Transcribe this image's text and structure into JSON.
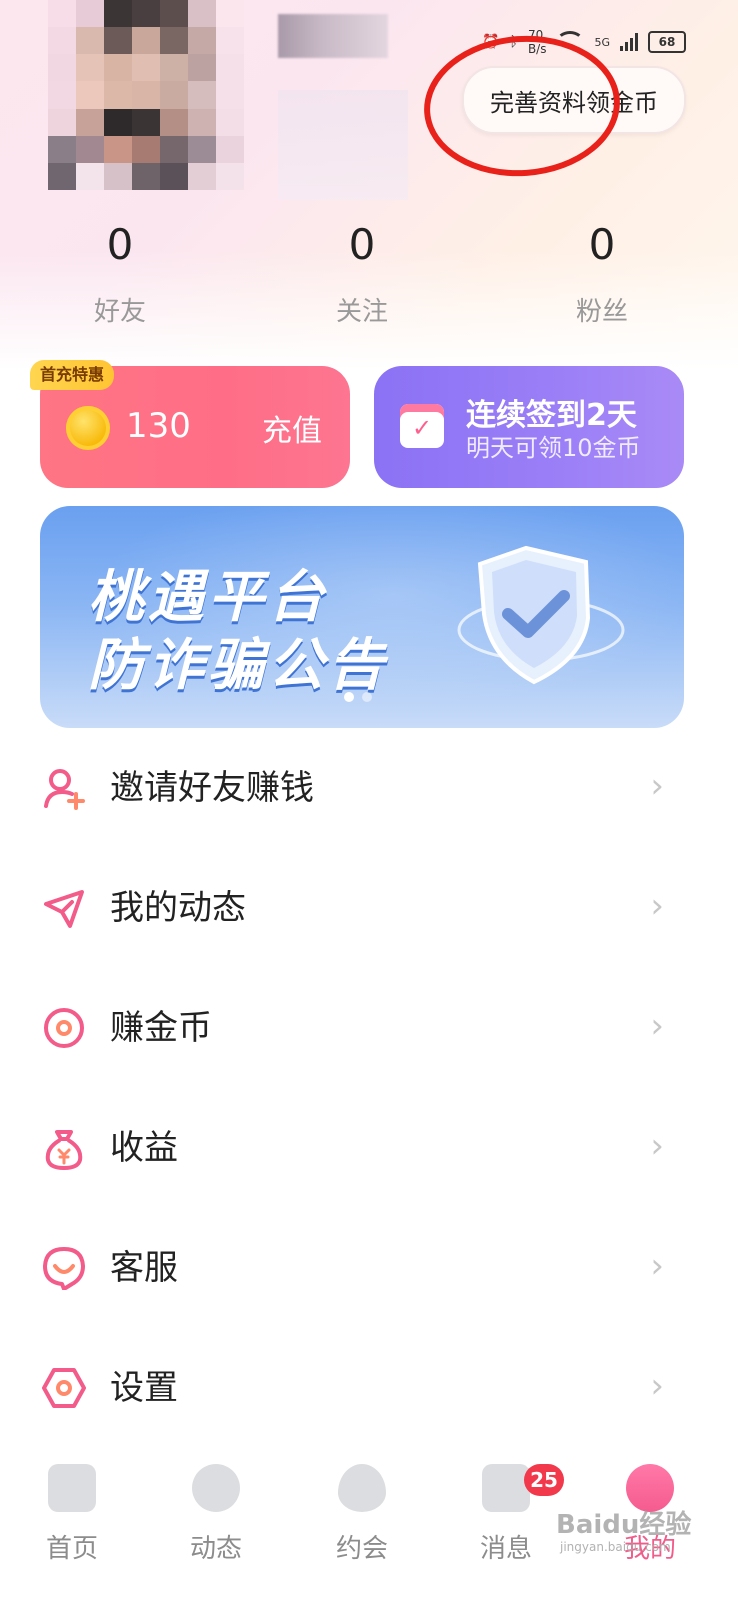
{
  "status_bar": {
    "speed": "70",
    "speed_unit": "B/s",
    "network": "5G",
    "battery": "68"
  },
  "profile": {
    "complete_button": "完善资料领金币"
  },
  "stats": [
    {
      "value": "0",
      "label": "好友"
    },
    {
      "value": "0",
      "label": "关注"
    },
    {
      "value": "0",
      "label": "粉丝"
    }
  ],
  "recharge_card": {
    "badge": "首充特惠",
    "coins": "130",
    "action": "充值"
  },
  "signin_card": {
    "title": "连续签到2天",
    "subtitle": "明天可领10金币"
  },
  "banner": {
    "line1": "桃遇平台",
    "line2": "防诈骗公告",
    "slides_total": 2,
    "slide_active": 1
  },
  "menu": [
    {
      "label": "邀请好友赚钱",
      "icon": "invite-user-icon"
    },
    {
      "label": "我的动态",
      "icon": "paper-plane-icon"
    },
    {
      "label": "赚金币",
      "icon": "coin-ring-icon"
    },
    {
      "label": "收益",
      "icon": "money-bag-icon"
    },
    {
      "label": "客服",
      "icon": "customer-service-icon"
    },
    {
      "label": "设置",
      "icon": "settings-hex-icon"
    }
  ],
  "tabbar": [
    {
      "label": "首页",
      "icon": "home-icon"
    },
    {
      "label": "动态",
      "icon": "compass-icon"
    },
    {
      "label": "约会",
      "icon": "heart-icon"
    },
    {
      "label": "消息",
      "icon": "message-icon",
      "badge": "25"
    },
    {
      "label": "我的",
      "icon": "profile-icon",
      "active": true
    }
  ],
  "watermark": {
    "text": "Baidu经验",
    "url": "jingyan.baidu.com"
  },
  "colors": {
    "accent_pink": "#f25b8a",
    "recharge": "#ff7585",
    "signin": "#8b72f5",
    "annotation_red": "#e8221b"
  }
}
